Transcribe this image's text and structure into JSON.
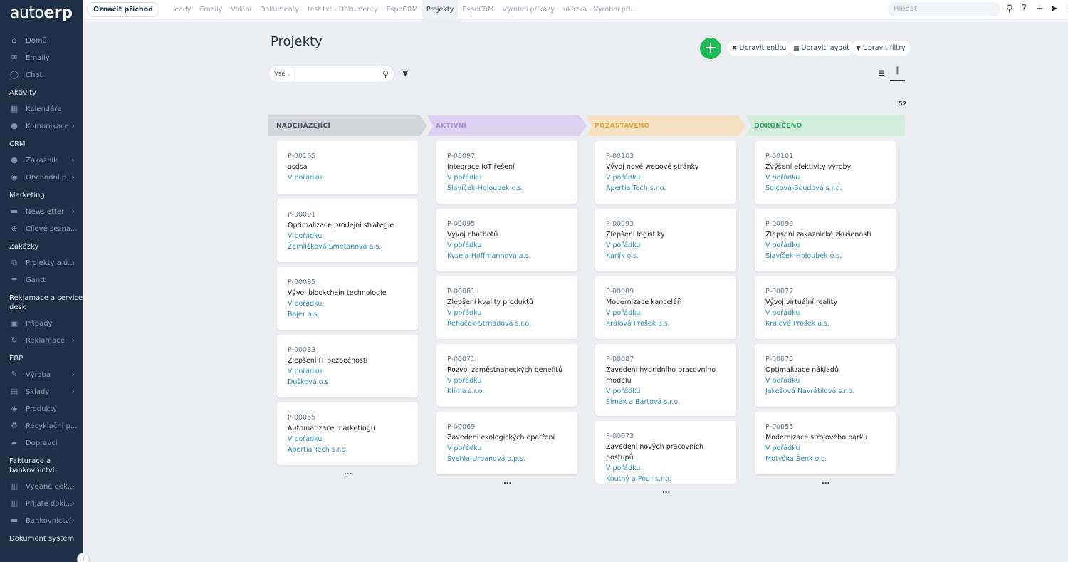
{
  "app": {
    "logo_light": "auto",
    "logo_bold": "erp"
  },
  "sidebar": {
    "entries": [
      {
        "kind": "item",
        "icon": "home-icon",
        "glyph": "⌂",
        "label": "Domů"
      },
      {
        "kind": "item",
        "icon": "email-icon",
        "glyph": "✉",
        "label": "Emaily"
      },
      {
        "kind": "item",
        "icon": "chat-icon",
        "glyph": "◯",
        "label": "Chat"
      },
      {
        "kind": "group",
        "label": "Aktivity"
      },
      {
        "kind": "item",
        "icon": "calendar-icon",
        "glyph": "▦",
        "label": "Kalendáře"
      },
      {
        "kind": "item",
        "icon": "communication-icon",
        "glyph": "●",
        "label": "Komunikace",
        "arrow": true
      },
      {
        "kind": "group",
        "label": "CRM"
      },
      {
        "kind": "item",
        "icon": "customer-icon",
        "glyph": "●",
        "label": "Zákazník",
        "arrow": true
      },
      {
        "kind": "item",
        "icon": "deals-icon",
        "glyph": "◉",
        "label": "Obchodní p...",
        "arrow": true
      },
      {
        "kind": "group",
        "label": "Marketing"
      },
      {
        "kind": "item",
        "icon": "newsletter-icon",
        "glyph": "▬",
        "label": "Newsletter",
        "arrow": true
      },
      {
        "kind": "item",
        "icon": "target-icon",
        "glyph": "⊕",
        "label": "Cílové sezna..."
      },
      {
        "kind": "group",
        "label": "Zakázky"
      },
      {
        "kind": "item",
        "icon": "projects-icon",
        "glyph": "⧉",
        "label": "Projekty a ú...",
        "arrow": true
      },
      {
        "kind": "item",
        "icon": "gantt-icon",
        "glyph": "≡",
        "label": "Gantt"
      },
      {
        "kind": "group",
        "label": "Reklamace a service desk"
      },
      {
        "kind": "item",
        "icon": "cases-icon",
        "glyph": "▣",
        "label": "Případy"
      },
      {
        "kind": "item",
        "icon": "complaints-icon",
        "glyph": "↻",
        "label": "Reklamace",
        "arrow": true
      },
      {
        "kind": "group",
        "label": "ERP"
      },
      {
        "kind": "item",
        "icon": "wrench-icon",
        "glyph": "✎",
        "label": "Výroba",
        "arrow": true
      },
      {
        "kind": "item",
        "icon": "warehouse-icon",
        "glyph": "▤",
        "label": "Sklady",
        "arrow": true
      },
      {
        "kind": "item",
        "icon": "products-icon",
        "glyph": "◈",
        "label": "Produkty"
      },
      {
        "kind": "item",
        "icon": "recycle-icon",
        "glyph": "♻",
        "label": "Recyklační p..."
      },
      {
        "kind": "item",
        "icon": "truck-icon",
        "glyph": "▰",
        "label": "Dopravci"
      },
      {
        "kind": "group",
        "label": "Fakturace a bankovnictví"
      },
      {
        "kind": "item",
        "icon": "issued-docs-icon",
        "glyph": "▥",
        "label": "Vydané dok...",
        "arrow": true
      },
      {
        "kind": "item",
        "icon": "received-docs-icon",
        "glyph": "▥",
        "label": "Přijaté doki...",
        "arrow": true
      },
      {
        "kind": "item",
        "icon": "banking-icon",
        "glyph": "▬",
        "label": "Bankovnictví",
        "arrow": true
      },
      {
        "kind": "group",
        "label": "Dokument system"
      }
    ]
  },
  "topbar": {
    "checkin_label": "Označit příchod",
    "tabs": [
      "Leady",
      "Emaily",
      "Volání",
      "Dokumenty",
      "test.txt - Dokumenty",
      "EspoCRM",
      "Projekty",
      "EspoCRM",
      "Výrobní příkazy",
      "ukázka - Výrobní pří..."
    ],
    "active_tab": 6,
    "search_placeholder": "Hledat"
  },
  "page": {
    "title": "Projekty",
    "actions": {
      "edit_entity": "Upravit entitu",
      "edit_layout": "Upravit layout",
      "edit_filters": "Upravit filtry"
    },
    "filter_select": "Vše",
    "total": "52"
  },
  "columns": [
    {
      "title": "NADCHÁZEJÍCÍ",
      "bg": "#d3d6db",
      "fg": "#4a5563",
      "more": "...",
      "cards": [
        {
          "num": "P-00105",
          "name": "asdsa",
          "status": "V pořádku",
          "account": ""
        },
        {
          "num": "P-00091",
          "name": "Optimalizace prodejní strategie",
          "status": "V pořádku",
          "account": "Žemličková Smetanová a.s."
        },
        {
          "num": "P-00085",
          "name": "Vývoj blockchain technologie",
          "status": "V pořádku",
          "account": "Bajer a.s."
        },
        {
          "num": "P-00083",
          "name": "Zlepšení IT bezpečnosti",
          "status": "V pořádku",
          "account": "Dušková o.s."
        },
        {
          "num": "P-00065",
          "name": "Automatizace marketingu",
          "status": "V pořádku",
          "account": "Apertia Tech s.r.o."
        }
      ]
    },
    {
      "title": "AKTIVNÍ",
      "bg": "#ddd2f1",
      "fg": "#a58fd6",
      "more": "...",
      "cards": [
        {
          "num": "P-00097",
          "name": "Integrace IoT řešení",
          "status": "V pořádku",
          "account": "Slavíček-Holoubek o.s."
        },
        {
          "num": "P-00095",
          "name": "Vývoj chatbotů",
          "status": "V pořádku",
          "account": "Kysela-Hoffmannová a.s."
        },
        {
          "num": "P-00081",
          "name": "Zlepšení kvality produktů",
          "status": "V pořádku",
          "account": "Řeháček-Strnadová s.r.o."
        },
        {
          "num": "P-00071",
          "name": "Rozvoj zaměstnaneckých benefitů",
          "status": "V pořádku",
          "account": "Klíma s.r.o."
        },
        {
          "num": "P-00069",
          "name": "Zavedení ekologických opatření",
          "status": "V pořádku",
          "account": "Švehla-Urbanová o.p.s."
        }
      ]
    },
    {
      "title": "POZASTAVENO",
      "bg": "#f6e2c2",
      "fg": "#e3a53c",
      "more": "...",
      "cards": [
        {
          "num": "P-00103",
          "name": "Vývoj nové webové stránky",
          "status": "V pořádku",
          "account": "Apertia Tech s.r.o."
        },
        {
          "num": "P-00093",
          "name": "Zlepšení logistiky",
          "status": "V pořádku",
          "account": "Karlík o.s."
        },
        {
          "num": "P-00089",
          "name": "Modernizace kanceláří",
          "status": "V pořádku",
          "account": "Králová Prošek a.s."
        },
        {
          "num": "P-00087",
          "name": "Zavedení hybridního pracovního modelu",
          "status": "V pořádku",
          "account": "Šimák a Bártová s.r.o."
        },
        {
          "num": "P-00073",
          "name": "Zavedení nových pracovních postupů",
          "status": "V pořádku",
          "account": "Koutný a Pour s.r.o."
        }
      ]
    },
    {
      "title": "DOKONČENO",
      "bg": "#d3eedc",
      "fg": "#2eab58",
      "more": "...",
      "cards": [
        {
          "num": "P-00101",
          "name": "Zvýšení efektivity výroby",
          "status": "V pořádku",
          "account": "Šolcová-Boudová s.r.o."
        },
        {
          "num": "P-00099",
          "name": "Zlepšení zákaznické zkušenosti",
          "status": "V pořádku",
          "account": "Slavíček-Holoubek o.s."
        },
        {
          "num": "P-00077",
          "name": "Vývoj virtuální reality",
          "status": "V pořádku",
          "account": "Králová Prošek a.s."
        },
        {
          "num": "P-00075",
          "name": "Optimalizace nákladů",
          "status": "V pořádku",
          "account": "Jakešová Navrátilová s.r.o."
        },
        {
          "num": "P-00055",
          "name": "Modernizace strojového parku",
          "status": "V pořádku",
          "account": "Motyčka-Šenk o.s."
        }
      ]
    }
  ]
}
